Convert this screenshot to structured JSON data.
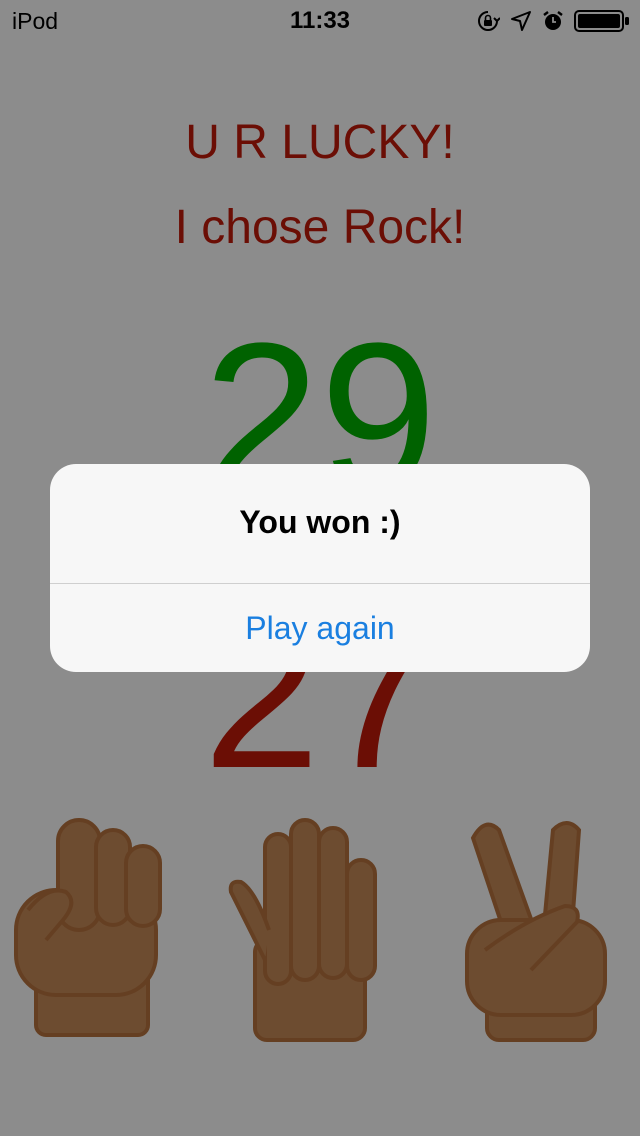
{
  "status_bar": {
    "carrier": "iPod",
    "time": "11:33",
    "icons": [
      "orientation-lock-icon",
      "location-arrow-icon",
      "alarm-clock-icon",
      "battery-icon"
    ]
  },
  "game": {
    "result_heading": "U R LUCKY!",
    "choice_heading": "I chose Rock!",
    "score_top": "29",
    "score_bottom": "27",
    "hands": [
      "rock-hand-icon",
      "paper-hand-icon",
      "scissors-hand-icon"
    ]
  },
  "alert": {
    "title": "You won :)",
    "button_label": "Play again"
  },
  "colors": {
    "heading_red": "#c41a0a",
    "score_green": "#00b300",
    "hand_skin": "#c78a58",
    "alert_button_blue": "#1a7fe0"
  }
}
